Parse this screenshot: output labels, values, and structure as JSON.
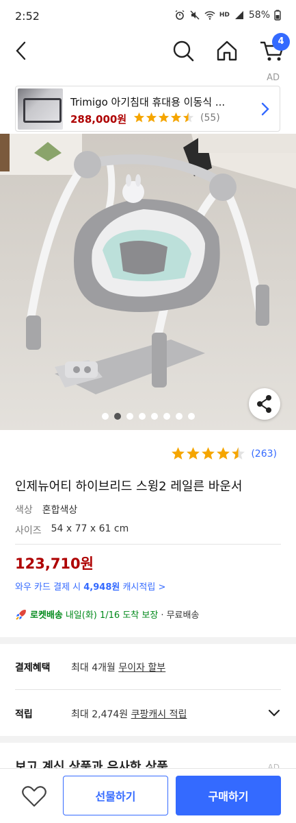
{
  "status_bar": {
    "time": "2:52",
    "battery": "58%",
    "network": "HD"
  },
  "nav": {
    "cart_count": "4"
  },
  "ad": {
    "label": "AD",
    "title": "Trimigo 아기침대 휴대용 이동식 ...",
    "price": "288,000원",
    "rating": 4.5,
    "review_count": "(55)"
  },
  "carousel": {
    "total": 8,
    "active_index": 1
  },
  "product": {
    "rating": 4.5,
    "review_count": "(263)",
    "title": "인제뉴어티 하이브리드 스윙2 레일른 바운서",
    "options": [
      {
        "key": "색상",
        "value": "혼합색상"
      },
      {
        "key": "사이즈",
        "value": "54 x 77 x 61 cm"
      }
    ],
    "price": "123,710원",
    "cash_prefix": "와우 카드 결제 시 ",
    "cash_amount": "4,948원",
    "cash_suffix": " 캐시적립 >",
    "rocket_brand": "로켓배송",
    "delivery_eta": "내일(화) 1/16 도착 보장",
    "delivery_free": "· 무료배송"
  },
  "benefits": {
    "payment_key": "결제혜택",
    "payment_value_prefix": "최대 4개월 ",
    "payment_value_link": "무이자 할부",
    "reward_key": "적립",
    "reward_value_prefix": "최대 2,474원 ",
    "reward_value_link": "쿠팡캐시 적립"
  },
  "related": {
    "title": "보고 계신 상품과 유사한 상품",
    "ad_label": "AD"
  },
  "bottom": {
    "gift_label": "선물하기",
    "buy_label": "구매하기"
  },
  "colors": {
    "accent": "#346aff",
    "price": "#ae0000",
    "rocket": "#00891a",
    "star": "#f5a500"
  }
}
